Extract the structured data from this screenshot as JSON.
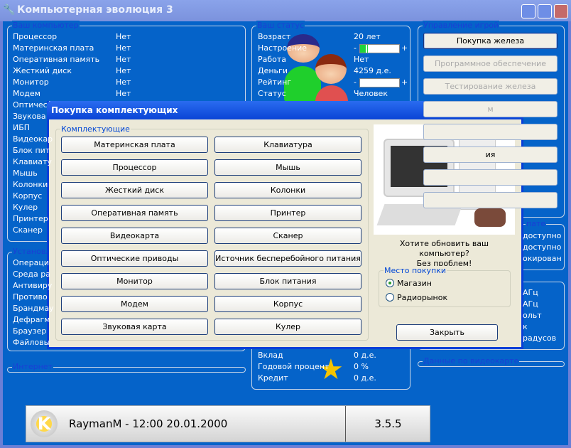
{
  "window": {
    "title": "Компьютерная эволюция 3"
  },
  "computer": {
    "legend": "Ваш компьютер",
    "rows": [
      [
        "Процессор",
        "Нет"
      ],
      [
        "Материнская плата",
        "Нет"
      ],
      [
        "Оперативная память",
        "Нет"
      ],
      [
        "Жесткий диск",
        "Нет"
      ],
      [
        "Монитор",
        "Нет"
      ],
      [
        "Модем",
        "Нет"
      ],
      [
        "Оптичес",
        ""
      ],
      [
        "Звукова",
        ""
      ],
      [
        "ИБП",
        ""
      ],
      [
        "Видеокар",
        ""
      ],
      [
        "Блок пит",
        ""
      ],
      [
        "Клавиату",
        ""
      ],
      [
        "Мышь",
        ""
      ],
      [
        "Колонки",
        ""
      ],
      [
        "Корпус",
        ""
      ],
      [
        "Кулер",
        ""
      ],
      [
        "Принтер",
        ""
      ],
      [
        "Сканер",
        ""
      ]
    ]
  },
  "software": {
    "legend": "Установл",
    "rows": [
      "Операци",
      "Среда ра",
      "Антивиру",
      "Противо",
      "Брандмау",
      "Дефрагм",
      "Браузер",
      "Файловы"
    ]
  },
  "internet": {
    "legend": "Интернет"
  },
  "status": {
    "legend": "Ваш статус",
    "rows": [
      [
        "Возраст",
        "20 лет"
      ],
      [
        "Настроение",
        ""
      ],
      [
        "Работа",
        "Нет"
      ],
      [
        "Деньги",
        "4259 д.е."
      ],
      [
        "Рейтинг",
        ""
      ],
      [
        "Статус",
        "Человек"
      ]
    ],
    "mood_level": 0.2,
    "rating_level": 0,
    "minus": "-",
    "plus": "+",
    "bank": [
      [
        "Вклад",
        "0 д.е."
      ],
      [
        "Годовой процент",
        "0 %"
      ],
      [
        "Кредит",
        "0 д.е."
      ]
    ]
  },
  "control": {
    "legend": "Управление игрой",
    "buttons": [
      "Покупка железа",
      "Программное обеспечение",
      "Тестирование железа",
      "м",
      "",
      "ия",
      "",
      ""
    ]
  },
  "right2": {
    "legend": "пате",
    "rows": [
      "доступно",
      "доступно",
      "окирован"
    ]
  },
  "right3": {
    "rows": [
      "АГц",
      "АГц",
      "ольт",
      "к",
      "радусов"
    ]
  },
  "video": {
    "legend": "Данные по видеокарте"
  },
  "dialog": {
    "title": "Покупка комплектующих",
    "group": "Комплектующие",
    "col1": [
      "Материнская плата",
      "Процессор",
      "Жесткий диск",
      "Оперативная память",
      "Видеокарта",
      "Оптические приводы",
      "Монитор",
      "Модем",
      "Звуковая карта"
    ],
    "col2": [
      "Клавиатура",
      "Мышь",
      "Колонки",
      "Принтер",
      "Сканер",
      "Источник бесперебойного питания",
      "Блок питания",
      "Корпус",
      "Кулер"
    ],
    "promo1": "Хотите обновить ваш компьютер?",
    "promo2": "Без проблем!",
    "place": {
      "legend": "Место покупки",
      "options": [
        "Магазин",
        "Радиорынок"
      ],
      "selected": "Магазин"
    },
    "close": "Закрыть"
  },
  "statusbar": {
    "text": "RaymanM - 12:00 20.01.2000",
    "version": "3.5.5"
  }
}
